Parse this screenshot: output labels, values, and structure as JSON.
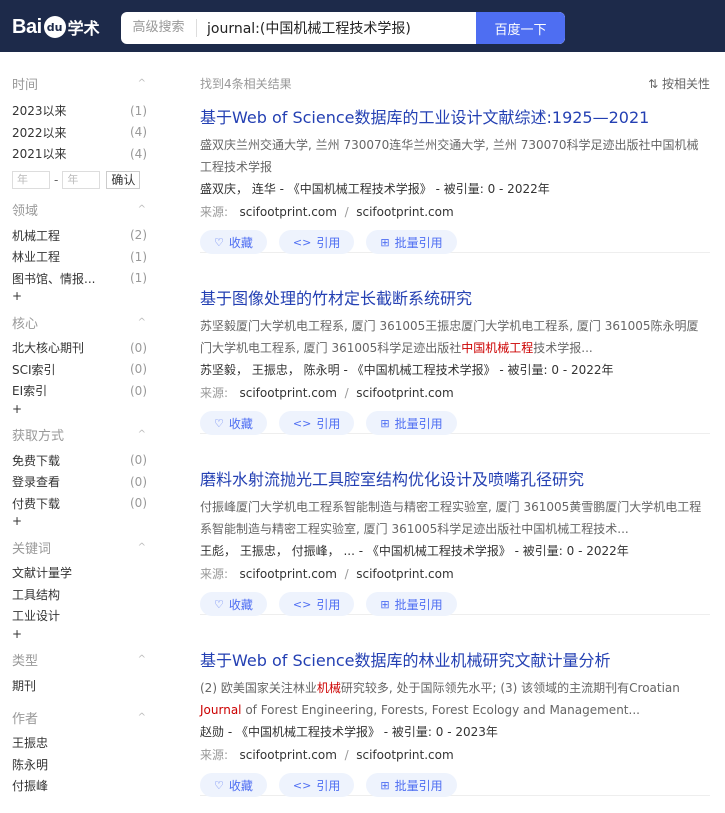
{
  "header": {
    "logo_bai": "Bai",
    "logo_paw": "du",
    "logo_xs": "学术",
    "adv_label": "高级搜索",
    "query": "journal:(中国机械工程技术学报)",
    "search_button": "百度一下"
  },
  "sidebar": {
    "time": {
      "title": "时间",
      "items": [
        {
          "label": "2023以来",
          "count": "(1)"
        },
        {
          "label": "2022以来",
          "count": "(4)"
        },
        {
          "label": "2021以来",
          "count": "(4)"
        }
      ],
      "year_from": "年",
      "year_to": "年",
      "confirm": "确认"
    },
    "field": {
      "title": "领域",
      "items": [
        {
          "label": "机械工程",
          "count": "(2)"
        },
        {
          "label": "林业工程",
          "count": "(1)"
        },
        {
          "label": "图书馆、情报...",
          "count": "(1)"
        }
      ]
    },
    "core": {
      "title": "核心",
      "items": [
        {
          "label": "北大核心期刊",
          "count": "(0)"
        },
        {
          "label": "SCI索引",
          "count": "(0)"
        },
        {
          "label": "EI索引",
          "count": "(0)"
        }
      ]
    },
    "access": {
      "title": "获取方式",
      "items": [
        {
          "label": "免费下载",
          "count": "(0)"
        },
        {
          "label": "登录查看",
          "count": "(0)"
        },
        {
          "label": "付费下载",
          "count": "(0)"
        }
      ]
    },
    "keywords": {
      "title": "关键词",
      "items": [
        {
          "label": "文献计量学"
        },
        {
          "label": "工具结构"
        },
        {
          "label": "工业设计"
        }
      ]
    },
    "type": {
      "title": "类型",
      "items": [
        {
          "label": "期刊"
        }
      ]
    },
    "author": {
      "title": "作者",
      "items": [
        {
          "label": "王振忠"
        },
        {
          "label": "陈永明"
        },
        {
          "label": "付振峰"
        }
      ]
    },
    "plus": "+",
    "chevron": "^"
  },
  "main": {
    "found": "找到4条相关结果",
    "sort": "按相关性",
    "source_label": "来源:",
    "actions": {
      "fav": "收藏",
      "cite": "引用",
      "batch": "批量引用"
    },
    "results": [
      {
        "title": "基于Web of Science数据库的工业设计文献综述:1925—2021",
        "abstract_a": "盛双庆兰州交通大学, 兰州 730070连华兰州交通大学, 兰州 730070科学足迹出版社中国机械工程技术学报",
        "abstract_hl": "",
        "abstract_b": "",
        "authors": "盛双庆，  连华  -  《中国机械工程技术学报》  -  被引量: 0  -  2022年",
        "source_a": "scifootprint.com",
        "source_b": "scifootprint.com"
      },
      {
        "title": "基于图像处理的竹材定长截断系统研究",
        "abstract_a": "苏坚毅厦门大学机电工程系, 厦门 361005王振忠厦门大学机电工程系, 厦门 361005陈永明厦门大学机电工程系, 厦门 361005科学足迹出版社",
        "abstract_hl": "中国机械工程",
        "abstract_b": "技术学报...",
        "authors": "苏坚毅，  王振忠，  陈永明  -  《中国机械工程技术学报》  -  被引量: 0  -  2022年",
        "source_a": "scifootprint.com",
        "source_b": "scifootprint.com"
      },
      {
        "title": "磨料水射流抛光工具腔室结构优化设计及喷嘴孔径研究",
        "abstract_a": "付振峰厦门大学机电工程系智能制造与精密工程实验室, 厦门 361005黄雪鹏厦门大学机电工程系智能制造与精密工程实验室, 厦门 361005科学足迹出版社中国机械工程技术...",
        "abstract_hl": "",
        "abstract_b": "",
        "authors": "王彪，  王振忠，  付振峰，  ... -  《中国机械工程技术学报》  -  被引量: 0  -  2022年",
        "source_a": "scifootprint.com",
        "source_b": "scifootprint.com"
      },
      {
        "title": "基于Web of Science数据库的林业机械研究文献计量分析",
        "abstract_a": "(2) 欧美国家关注林业",
        "abstract_hl": "机械",
        "abstract_b": "研究较多, 处于国际领先水平; (3) 该领域的主流期刊有Croatian ",
        "abstract_hl2": "Journal",
        "abstract_c": " of Forest Engineering, Forests, Forest Ecology and Management...",
        "authors": "赵勋  -  《中国机械工程技术学报》  -  被引量: 0  -  2023年",
        "source_a": "scifootprint.com",
        "source_b": "scifootprint.com"
      }
    ]
  }
}
